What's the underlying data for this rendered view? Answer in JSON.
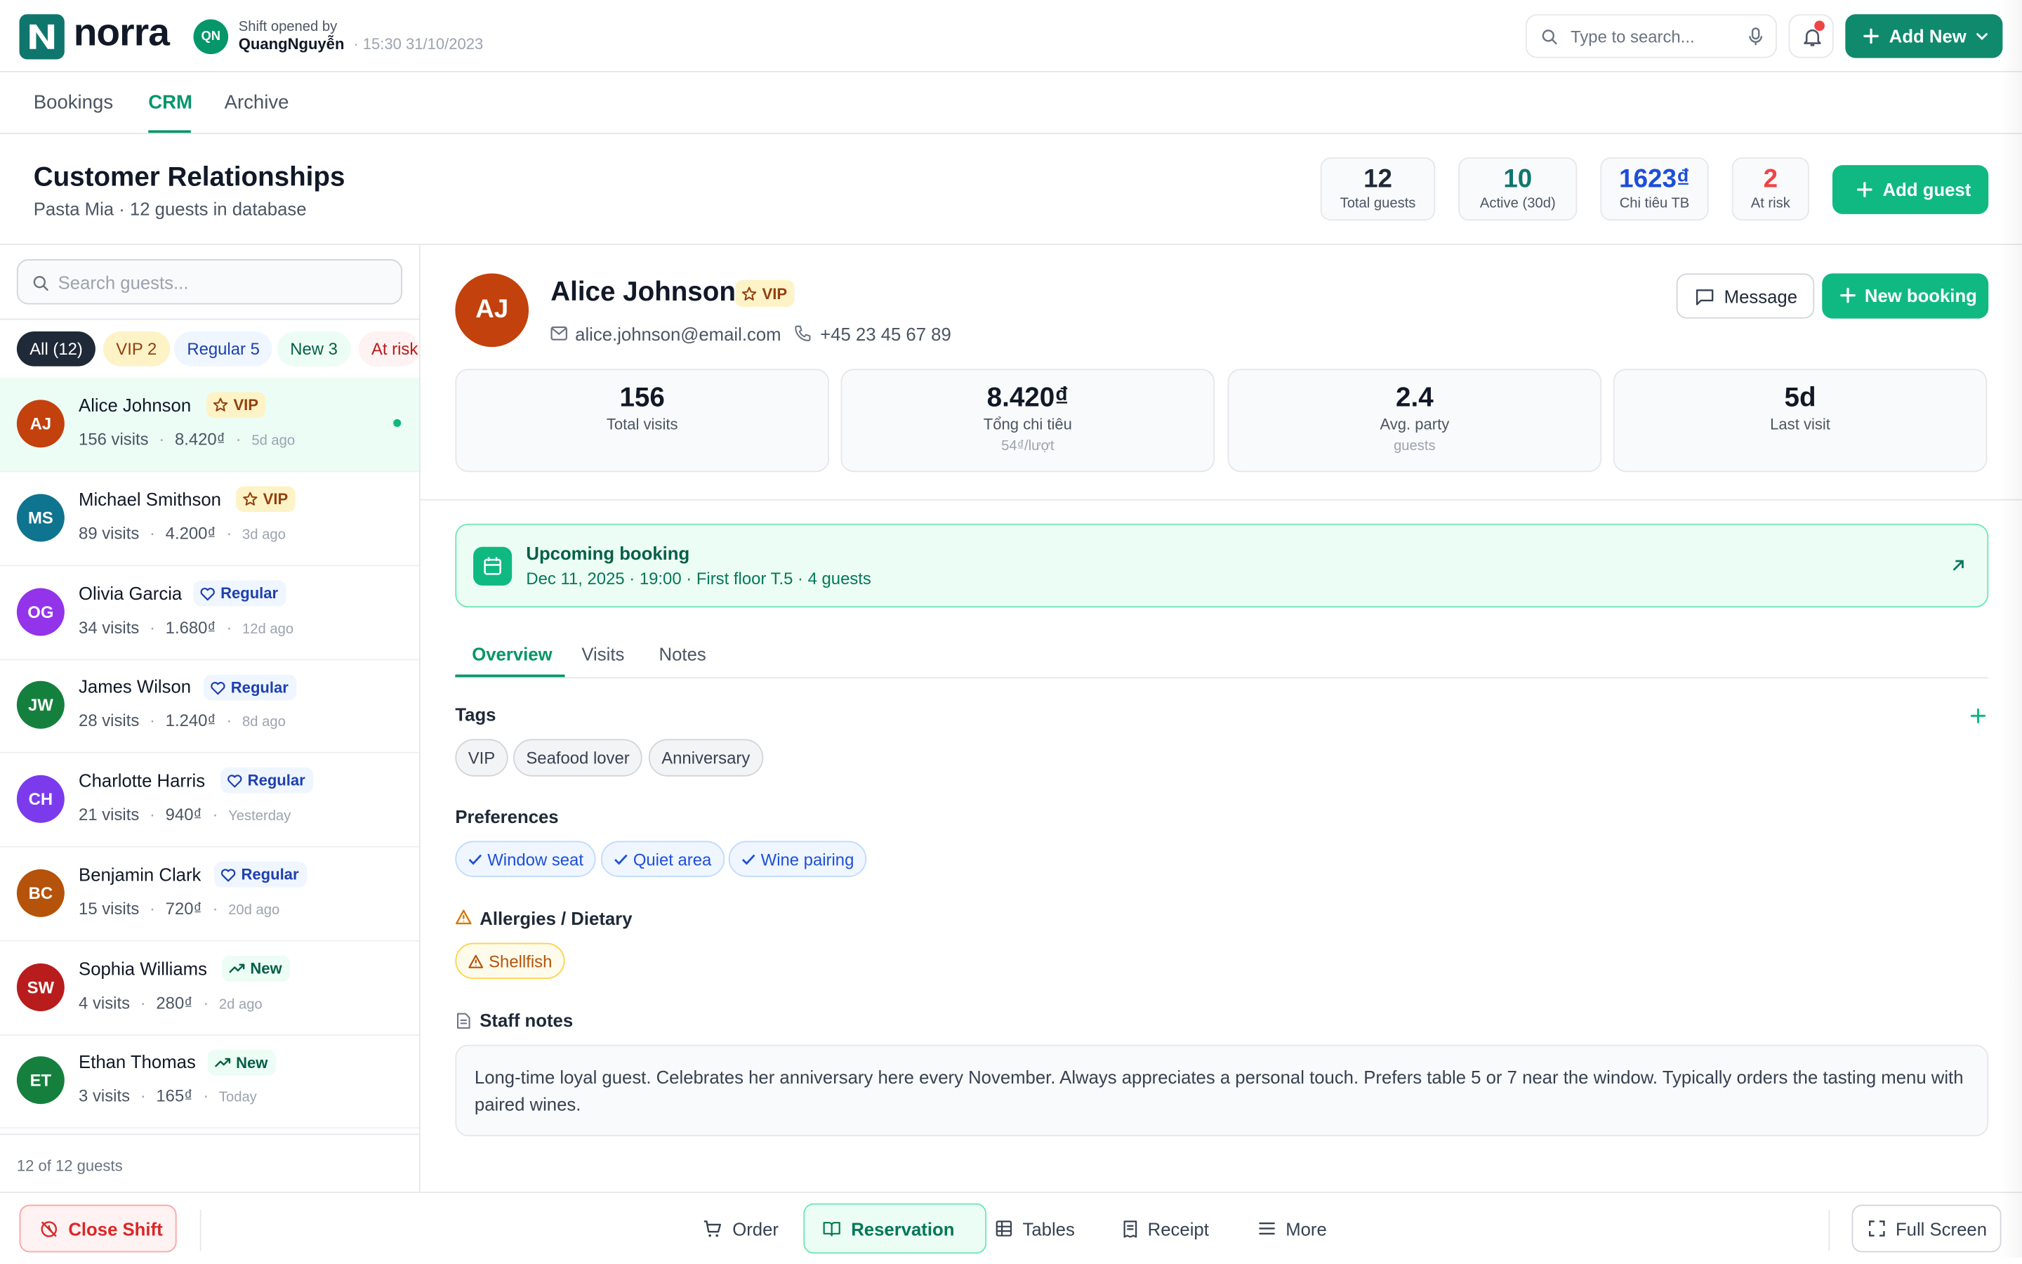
{
  "brand": {
    "name": "norra",
    "logo_letter": "N"
  },
  "shift": {
    "initials": "QN",
    "label": "Shift opened by",
    "user": "QuangNguyễn",
    "time": "· 15:30 31/10/2023"
  },
  "top": {
    "search_placeholder": "Type to search...",
    "add_new_label": "Add New"
  },
  "tabs": [
    "Bookings",
    "CRM",
    "Archive"
  ],
  "header": {
    "title": "Customer Relationships",
    "subtitle": "Pasta Mia · 12 guests in database",
    "stats": [
      {
        "value": "12",
        "label": "Total guests",
        "color": "#1f2937"
      },
      {
        "value": "10",
        "label": "Active (30d)",
        "color": "#0f766e"
      },
      {
        "value": "1623₫",
        "label": "Chi tiêu TB",
        "color": "#1d4ed8"
      },
      {
        "value": "2",
        "label": "At risk",
        "color": "#ef4444"
      }
    ],
    "add_guest_label": "Add guest"
  },
  "guest_list": {
    "search_placeholder": "Search guests...",
    "filters": [
      "All (12)",
      "VIP 2",
      "Regular 5",
      "New 3",
      "At risk"
    ],
    "guests": [
      {
        "initials": "AJ",
        "name": "Alice Johnson",
        "badge": "VIP",
        "visits": "156 visits",
        "spent": "8.420₫",
        "ago": "5d ago",
        "color": "#c2410c"
      },
      {
        "initials": "MS",
        "name": "Michael Smithson",
        "badge": "VIP",
        "visits": "89 visits",
        "spent": "4.200₫",
        "ago": "3d ago",
        "color": "#0e7490"
      },
      {
        "initials": "OG",
        "name": "Olivia Garcia",
        "badge": "Regular",
        "visits": "34 visits",
        "spent": "1.680₫",
        "ago": "12d ago",
        "color": "#9333ea"
      },
      {
        "initials": "JW",
        "name": "James Wilson",
        "badge": "Regular",
        "visits": "28 visits",
        "spent": "1.240₫",
        "ago": "8d ago",
        "color": "#15803d"
      },
      {
        "initials": "CH",
        "name": "Charlotte Harris",
        "badge": "Regular",
        "visits": "21 visits",
        "spent": "940₫",
        "ago": "Yesterday",
        "color": "#7c3aed"
      },
      {
        "initials": "BC",
        "name": "Benjamin Clark",
        "badge": "Regular",
        "visits": "15 visits",
        "spent": "720₫",
        "ago": "20d ago",
        "color": "#b45309"
      },
      {
        "initials": "SW",
        "name": "Sophia Williams",
        "badge": "New",
        "visits": "4 visits",
        "spent": "280₫",
        "ago": "2d ago",
        "color": "#b91c1c"
      },
      {
        "initials": "ET",
        "name": "Ethan Thomas",
        "badge": "New",
        "visits": "3 visits",
        "spent": "165₫",
        "ago": "Today",
        "color": "#15803d"
      }
    ],
    "footer": "12 of 12 guests"
  },
  "detail": {
    "initials": "AJ",
    "name": "Alice Johnson",
    "badge": "VIP",
    "email": "alice.johnson@email.com",
    "phone": "+45 23 45 67 89",
    "message_label": "Message",
    "new_booking_label": "New booking",
    "kpis": [
      {
        "value": "156",
        "label": "Total visits",
        "sub": ""
      },
      {
        "value": "8.420₫",
        "label": "Tổng chi tiêu",
        "sub": "54₫/lượt"
      },
      {
        "value": "2.4",
        "label": "Avg. party",
        "sub": "guests"
      },
      {
        "value": "5d",
        "label": "Last visit",
        "sub": ""
      }
    ],
    "upcoming": {
      "title": "Upcoming booking",
      "details": "Dec 11, 2025 · 19:00 · First floor T.5 · 4 guests"
    },
    "tabs": [
      "Overview",
      "Visits",
      "Notes"
    ],
    "tags_title": "Tags",
    "tags": [
      "VIP",
      "Seafood lover",
      "Anniversary"
    ],
    "preferences_title": "Preferences",
    "preferences": [
      "Window seat",
      "Quiet area",
      "Wine pairing"
    ],
    "allergies_title": "Allergies / Dietary",
    "allergies": [
      "Shellfish"
    ],
    "notes_title": "Staff notes",
    "notes": "Long-time loyal guest. Celebrates her anniversary here every November. Always appreciates a personal touch. Prefers table 5 or 7 near the window. Typically orders the tasting menu with paired wines."
  },
  "bottom": {
    "close_shift": "Close Shift",
    "nav": [
      "Order",
      "Reservation",
      "Tables",
      "Receipt",
      "More"
    ],
    "fullscreen": "Full Screen"
  }
}
